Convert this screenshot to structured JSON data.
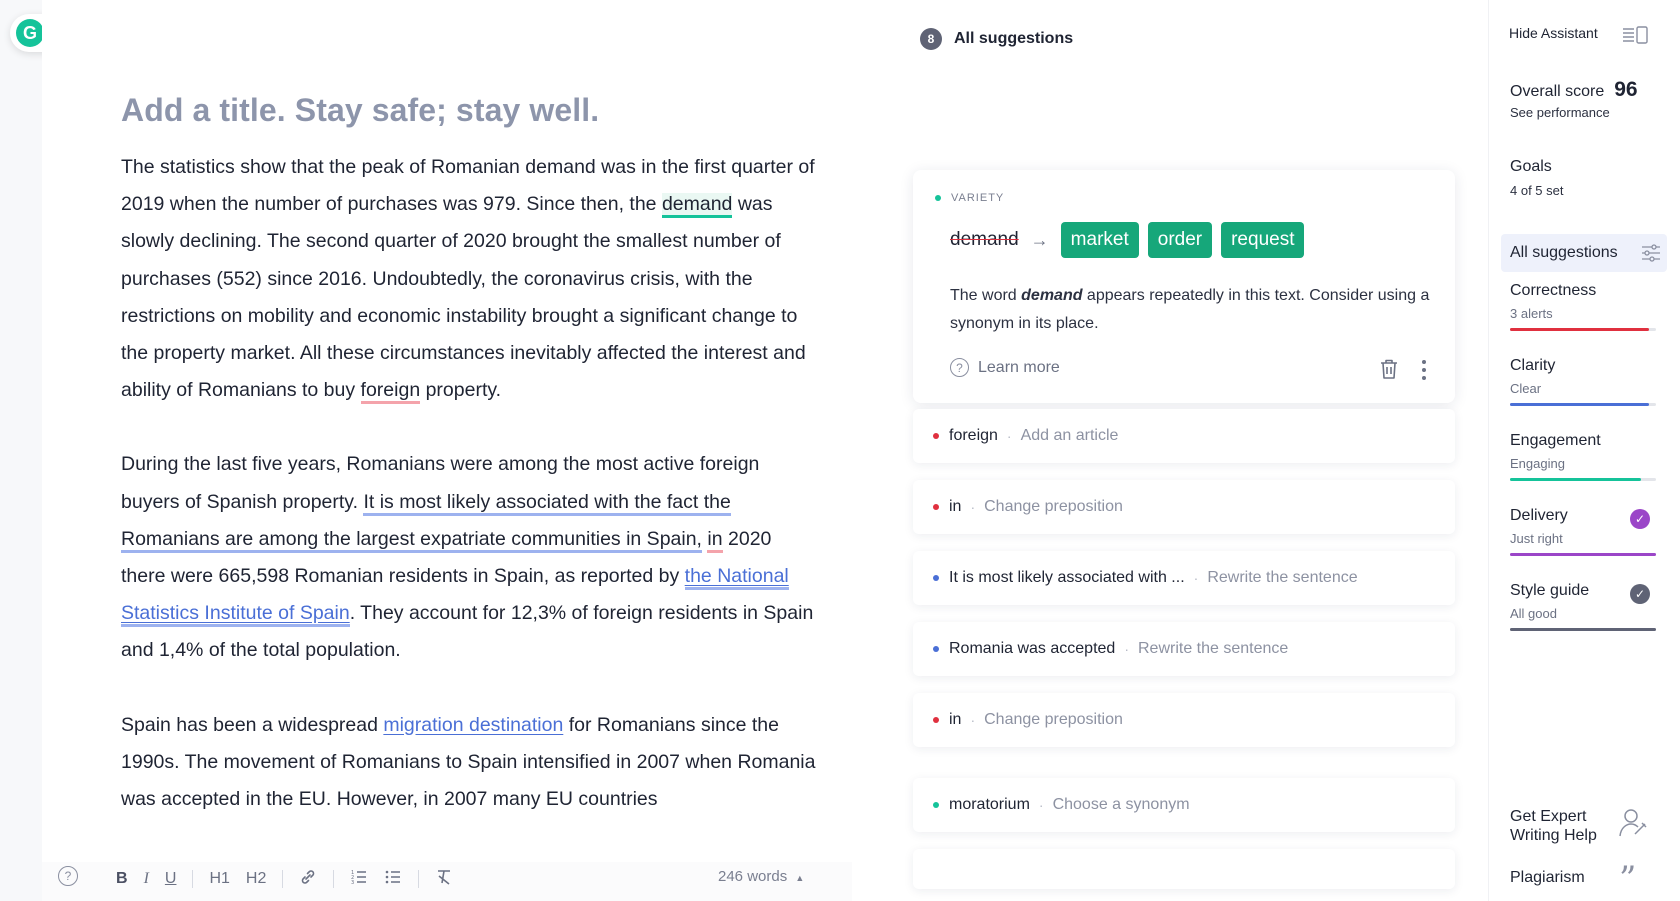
{
  "editor": {
    "title": "Add a title. Stay safe; stay well.",
    "p1": {
      "a": "The statistics show that the peak of Romanian demand was in the first quarter of 2019 when the number of purchases was 979. Since then, the ",
      "hl_demand": "demand",
      "b": " was slowly declining. The second quarter of 2020 brought the smallest number of purchases (552) since 2016. Undoubtedly, the coronavirus crisis, with the restrictions on mobility and economic instability brought a significant change to the property market. All these circumstances inevitably affected the interest and ability of Romanians to buy ",
      "hl_foreign": "foreign",
      "c": " property."
    },
    "p2": {
      "a": "During the last five years, Romanians were among the most active foreign buyers of Spanish property. ",
      "hl_sentence": "It is most likely associated with the fact the Romanians are among the largest expatriate communities in Spain,",
      "b": " ",
      "hl_in": "in",
      "c": " 2020 there were 665,598 Romanian residents in Spain, as reported by ",
      "link": "the National Statistics Institute of Spain",
      "d": ". They account for 12,3% of foreign residents in Spain and 1,4% of the total population."
    },
    "p3": {
      "a": "Spain has been a widespread ",
      "link": "migration destination",
      "b": " for Romanians since the 1990s. The movement of Romanians to Spain intensified in 2007 when Romania was accepted in the EU. However, in 2007 many EU countries"
    },
    "word_count": "246 words",
    "toolbar": {
      "bold": "B",
      "italic": "I",
      "underline": "U",
      "h1": "H1",
      "h2": "H2"
    }
  },
  "suggestions": {
    "count": "8",
    "header": "All suggestions",
    "active": {
      "category": "VARIETY",
      "original": "demand",
      "replacements": [
        "market",
        "order",
        "request"
      ],
      "desc_a": "The word ",
      "desc_word": "demand",
      "desc_b": " appears repeatedly in this text. Consider using a synonym in its place.",
      "learn_more": "Learn more",
      "dot_color": "#15c39a"
    },
    "cards": [
      {
        "word": "foreign",
        "hint": "Add an article",
        "dot": "#e0303f"
      },
      {
        "word": "in",
        "hint": "Change preposition",
        "dot": "#e0303f"
      },
      {
        "word": "It is most likely associated with ...",
        "hint": "Rewrite the sentence",
        "dot": "#4a6fd6"
      },
      {
        "word": "Romania was accepted",
        "hint": "Rewrite the sentence",
        "dot": "#4a6fd6"
      },
      {
        "word": "in",
        "hint": "Change preposition",
        "dot": "#e0303f"
      },
      {
        "word": "moratorium",
        "hint": "Choose a synonym",
        "dot": "#15c39a"
      }
    ]
  },
  "sidebar": {
    "hide_assistant": "Hide Assistant",
    "overall_label": "Overall score",
    "overall_value": "96",
    "see_performance": "See performance",
    "goals": "Goals",
    "goals_sub": "4 of 5 set",
    "all_suggestions": "All suggestions",
    "categories": [
      {
        "title": "Correctness",
        "sub": "3 alerts",
        "color": "#e0303f",
        "fill": 0.95
      },
      {
        "title": "Clarity",
        "sub": "Clear",
        "color": "#4a6fd6",
        "fill": 0.95
      },
      {
        "title": "Engagement",
        "sub": "Engaging",
        "color": "#15c39a",
        "fill": 0.9
      },
      {
        "title": "Delivery",
        "sub": "Just right",
        "color": "#9b46c8",
        "fill": 1.0
      },
      {
        "title": "Style guide",
        "sub": "All good",
        "color": "#5f6375",
        "fill": 1.0
      }
    ],
    "expert": "Get Expert Writing Help",
    "plagiarism": "Plagiarism"
  },
  "colors": {
    "brand": "#15c39a",
    "synonym_bg": "#16a77a",
    "delivery_check": "#9b46c8",
    "styleguide_check": "#5f6375"
  },
  "icons": {
    "logo": "grammarly-g-icon",
    "menu": "menu-icon",
    "help": "help-icon",
    "trash": "trash-icon",
    "more": "kebab-icon",
    "filter": "filter-icon",
    "layout": "layout-icon",
    "expert": "expert-icon",
    "plagiarism": "quote-icon"
  }
}
